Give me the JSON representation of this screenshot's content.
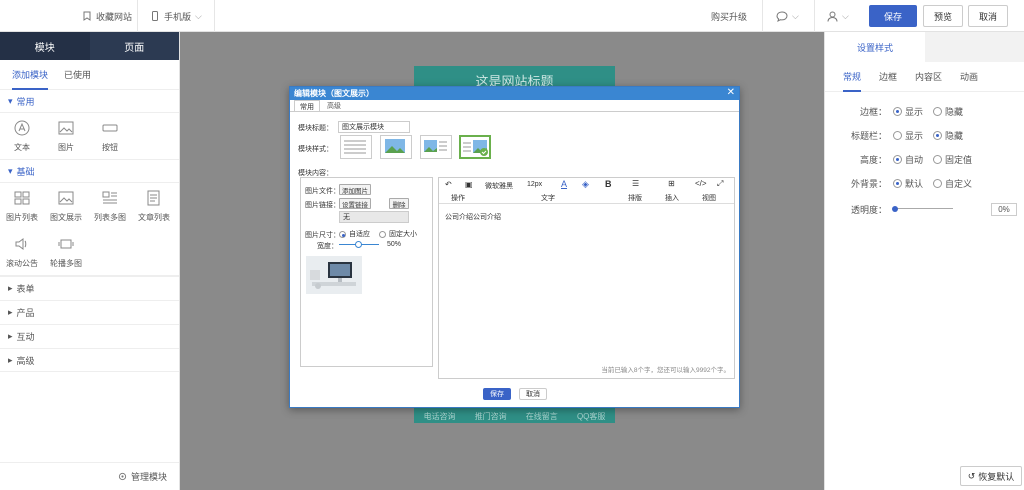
{
  "topbar": {
    "collect_label": "收藏网站",
    "device_label": "手机版",
    "upgrade_label": "购买升级",
    "save_label": "保存",
    "preview_label": "预览",
    "cancel_label": "取消"
  },
  "left_panel": {
    "tabs": [
      "模块",
      "页面"
    ],
    "subtabs": [
      "添加模块",
      "已使用"
    ],
    "categories": {
      "common": {
        "title": "常用",
        "items": [
          "文本",
          "图片",
          "按钮"
        ]
      },
      "basic": {
        "title": "基础",
        "items": [
          "图片列表",
          "图文展示",
          "列表多图",
          "文章列表",
          "滚动公告",
          "轮播多图"
        ]
      },
      "collapsed": [
        "表单",
        "产品",
        "互动",
        "高级"
      ]
    },
    "bottom_label": "管理模块"
  },
  "canvas": {
    "site_title": "这是网站标题",
    "nav": [
      "电话咨询",
      "推门咨询",
      "在线留言",
      "QQ客服"
    ]
  },
  "modal": {
    "title": "编辑模块（图文展示）",
    "tabs": [
      "常用",
      "高级"
    ],
    "module_title_label": "模块标题：",
    "module_title_value": "图文展示模块",
    "module_style_label": "模块样式：",
    "module_content_label": "模块内容：",
    "image_file_label": "图片文件：",
    "add_image_btn": "添加图片",
    "image_link_label": "图片链接：",
    "set_link_btn": "设置链接",
    "delete_btn": "删除",
    "link_value": "无",
    "image_size_label": "图片尺寸：",
    "size_auto": "自适应",
    "size_fixed": "固定大小",
    "width_label": "宽度：",
    "width_value": "50%",
    "editor": {
      "toolbar_op": "操作",
      "toolbar_font": "微软雅黑",
      "toolbar_size": "12px",
      "toolbar_text": "文字",
      "toolbar_layout": "排版",
      "toolbar_insert": "插入",
      "toolbar_view": "视图",
      "content": "公司介绍公司介绍",
      "counter": "当前已输入8个字，您还可以输入9992个字。"
    },
    "save_btn": "保存",
    "cancel_btn": "取消"
  },
  "right_panel": {
    "tab": "设置样式",
    "subtabs": [
      "常规",
      "边框",
      "内容区",
      "动画"
    ],
    "rows": {
      "border": {
        "label": "边框：",
        "opt1": "显示",
        "opt2": "隐藏"
      },
      "titlebar": {
        "label": "标题栏：",
        "opt1": "显示",
        "opt2": "隐藏"
      },
      "height": {
        "label": "高度：",
        "opt1": "自动",
        "opt2": "固定值"
      },
      "bg": {
        "label": "外背景：",
        "opt1": "默认",
        "opt2": "自定义"
      },
      "opacity": {
        "label": "透明度：",
        "value": "0%"
      }
    },
    "restore_label": "恢复默认"
  },
  "colors": {
    "accent": "#3a63c7",
    "canvas_teal": "#2f8f86",
    "dialog_header": "#3a86d2",
    "left_header": "#2c3a52"
  }
}
